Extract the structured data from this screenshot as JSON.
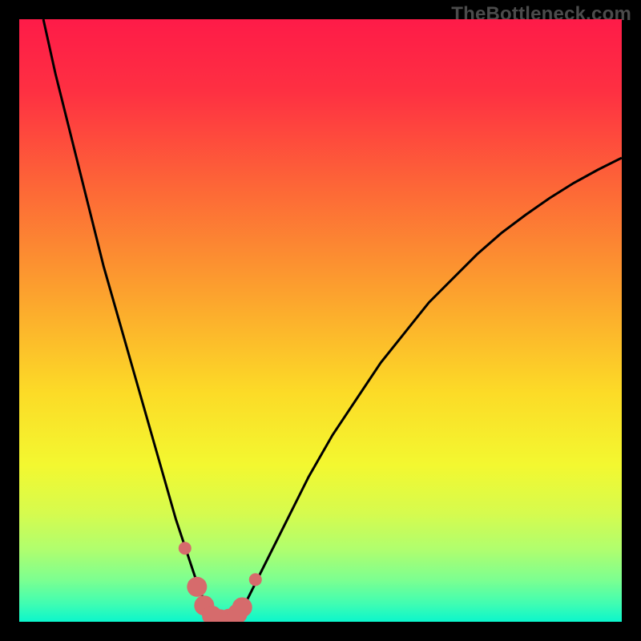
{
  "watermark": "TheBottleneck.com",
  "colors": {
    "bg": "#000000",
    "gradient_stops": [
      {
        "offset": 0.0,
        "color": "#fe1b48"
      },
      {
        "offset": 0.12,
        "color": "#fe3042"
      },
      {
        "offset": 0.28,
        "color": "#fd6737"
      },
      {
        "offset": 0.45,
        "color": "#fca02e"
      },
      {
        "offset": 0.62,
        "color": "#fcdb27"
      },
      {
        "offset": 0.74,
        "color": "#f3f830"
      },
      {
        "offset": 0.82,
        "color": "#d6fb4e"
      },
      {
        "offset": 0.88,
        "color": "#b0fe6e"
      },
      {
        "offset": 0.93,
        "color": "#7dff90"
      },
      {
        "offset": 0.97,
        "color": "#40fdb2"
      },
      {
        "offset": 1.0,
        "color": "#0bf6cc"
      }
    ],
    "curve": "#000000",
    "marker_fill": "#d66b6c",
    "marker_stroke": "#d66b6c"
  },
  "chart_data": {
    "type": "line",
    "title": "",
    "xlabel": "",
    "ylabel": "",
    "xlim": [
      0,
      100
    ],
    "ylim": [
      0,
      100
    ],
    "grid": false,
    "legend": false,
    "series": [
      {
        "name": "bottleneck-curve",
        "x": [
          4,
          6,
          8,
          10,
          12,
          14,
          16,
          18,
          20,
          22,
          24,
          26,
          27,
          28,
          29,
          30,
          31,
          32,
          33,
          34,
          35,
          36,
          37,
          38,
          40,
          44,
          48,
          52,
          56,
          60,
          64,
          68,
          72,
          76,
          80,
          84,
          88,
          92,
          96,
          100
        ],
        "y": [
          100,
          91,
          83,
          75,
          67,
          59,
          52,
          45,
          38,
          31,
          24,
          17,
          14,
          11,
          8,
          5,
          3,
          1.5,
          0.7,
          0.3,
          0.3,
          0.8,
          2,
          4,
          8,
          16,
          24,
          31,
          37,
          43,
          48,
          53,
          57,
          61,
          64.5,
          67.5,
          70.3,
          72.8,
          75,
          77
        ]
      }
    ],
    "markers": {
      "name": "highlighted-points",
      "x": [
        27.5,
        29.5,
        30.7,
        32,
        33.4,
        34.8,
        36.2,
        37.0,
        39.2
      ],
      "y": [
        12.2,
        5.8,
        2.7,
        1.0,
        0.4,
        0.5,
        1.3,
        2.4,
        7.0
      ],
      "radius_default": 12.5,
      "radius_small": 8
    }
  }
}
